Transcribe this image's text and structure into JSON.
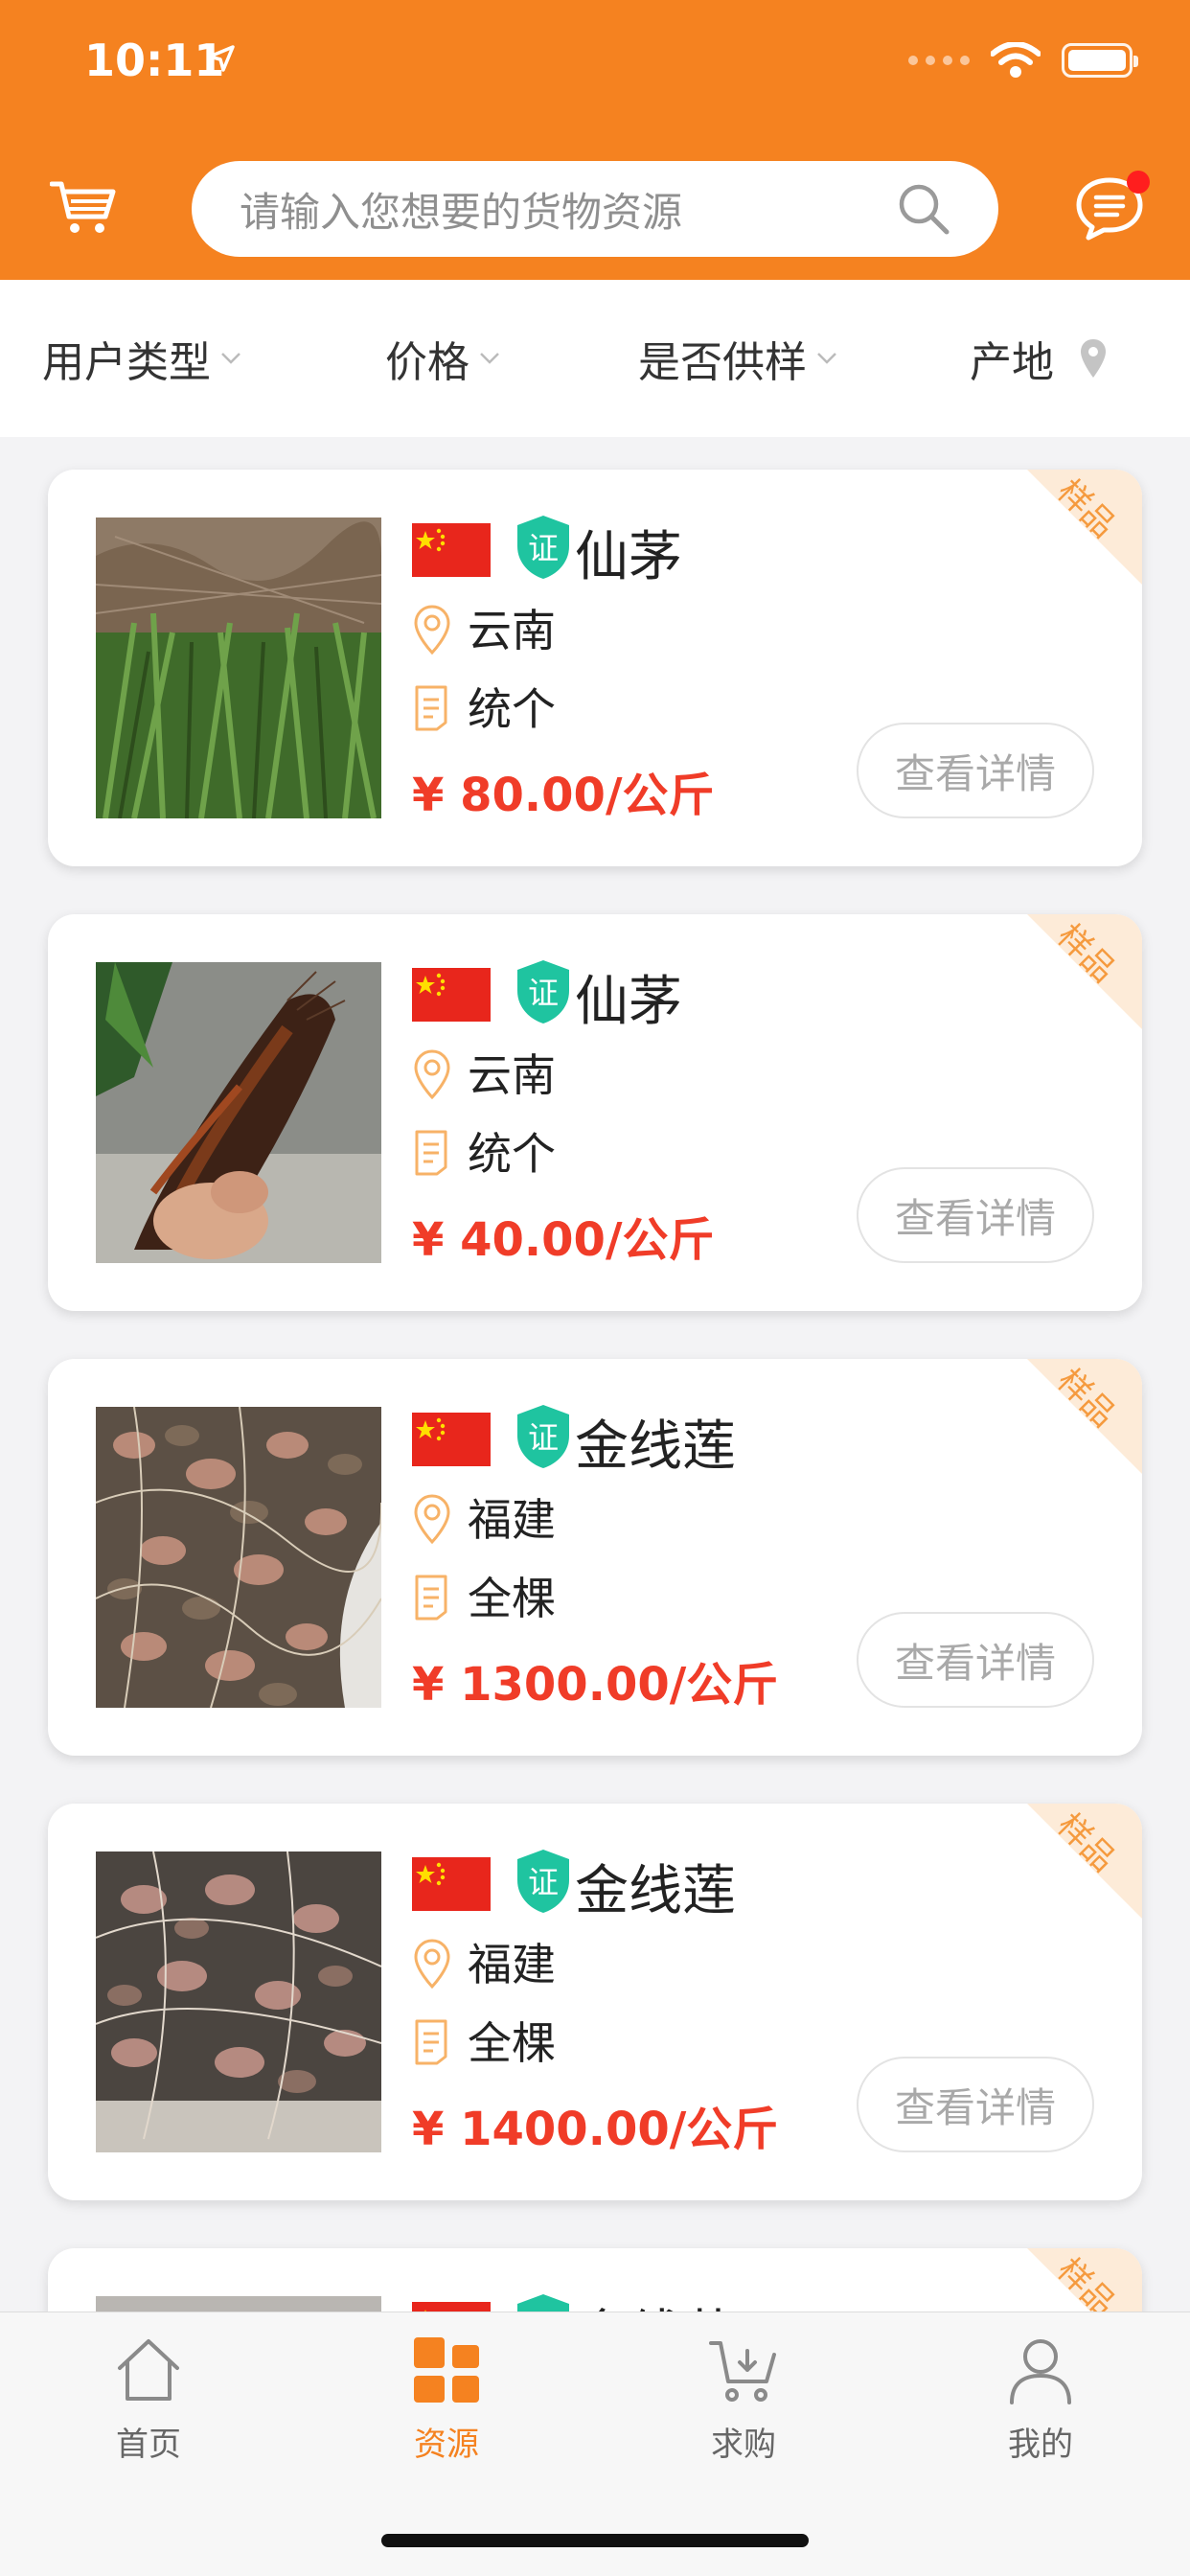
{
  "status_bar": {
    "time": "10:11"
  },
  "header": {
    "search_placeholder": "请输入您想要的货物资源"
  },
  "filters": [
    {
      "label": "用户类型"
    },
    {
      "label": "价格"
    },
    {
      "label": "是否供样"
    },
    {
      "label": "产地"
    }
  ],
  "products": [
    {
      "name": "仙茅",
      "origin": "云南",
      "spec": "统个",
      "price": "¥ 80.00/公斤",
      "detail_label": "查看详情",
      "tag": "样品"
    },
    {
      "name": "仙茅",
      "origin": "云南",
      "spec": "统个",
      "price": "¥ 40.00/公斤",
      "detail_label": "查看详情",
      "tag": "样品"
    },
    {
      "name": "金线莲",
      "origin": "福建",
      "spec": "全棵",
      "price": "¥ 1300.00/公斤",
      "detail_label": "查看详情",
      "tag": "样品"
    },
    {
      "name": "金线莲",
      "origin": "福建",
      "spec": "全棵",
      "price": "¥ 1400.00/公斤",
      "detail_label": "查看详情",
      "tag": "样品"
    },
    {
      "name": "金线莲",
      "tag": "样品"
    }
  ],
  "tabs": [
    {
      "label": "首页",
      "icon": "home-icon"
    },
    {
      "label": "资源",
      "icon": "grid-icon"
    },
    {
      "label": "求购",
      "icon": "purchase-cart-icon"
    },
    {
      "label": "我的",
      "icon": "user-icon"
    }
  ],
  "colors": {
    "brand": "#f58220",
    "price": "#f03c28",
    "cert": "#1fc4a0"
  }
}
